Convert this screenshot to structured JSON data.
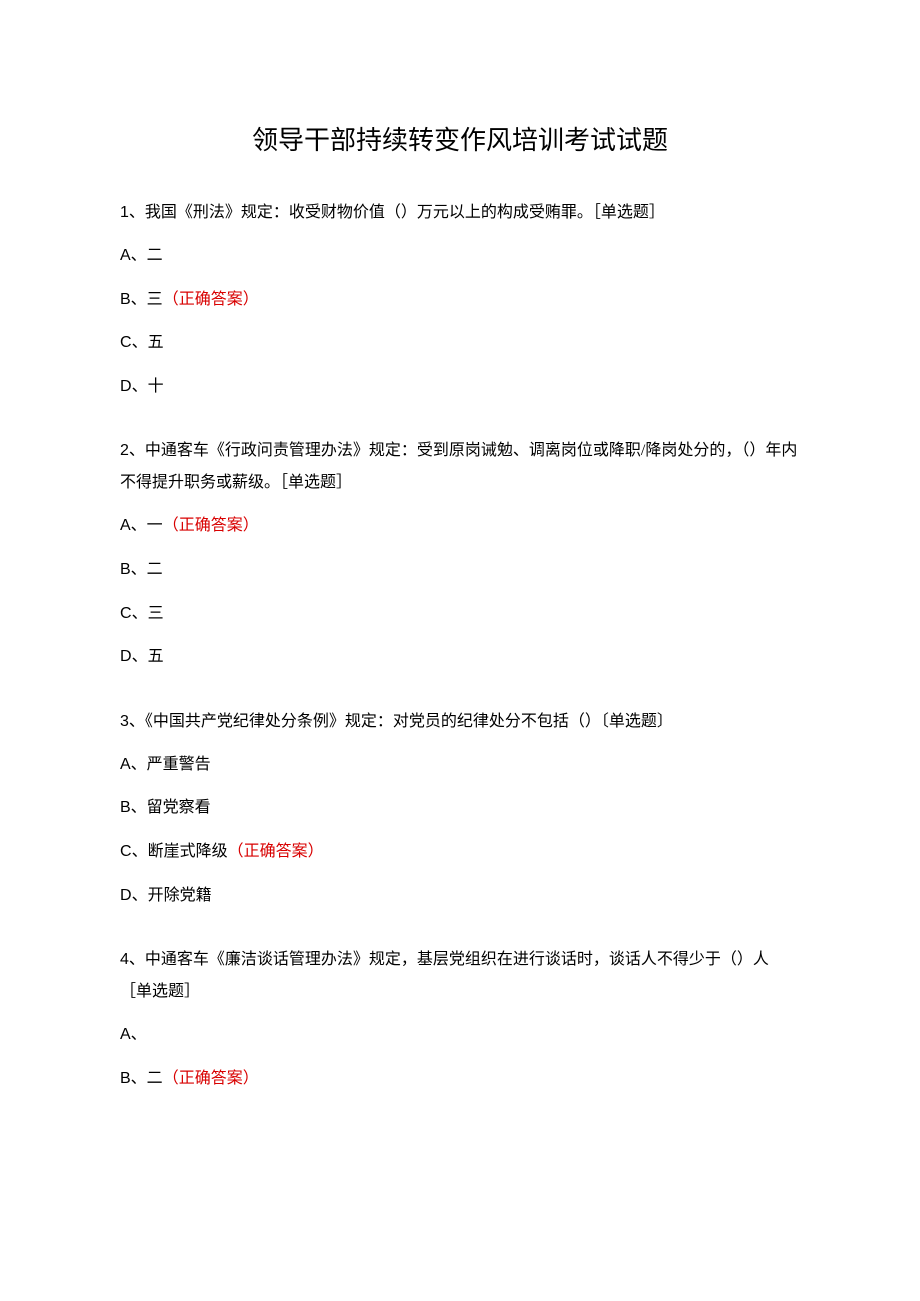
{
  "title": "领导干部持续转变作风培训考试试题",
  "correct_label": "（正确答案）",
  "questions": [
    {
      "number": "1",
      "text": "、我国《刑法》规定：收受财物价值（）万元以上的构成受贿罪。",
      "tag": "［单选题］",
      "options": [
        {
          "letter": "A",
          "text": "、二",
          "correct": false
        },
        {
          "letter": "B",
          "text": "、三",
          "correct": true
        },
        {
          "letter": "C",
          "text": "、五",
          "correct": false
        },
        {
          "letter": "D",
          "text": "、十",
          "correct": false
        }
      ]
    },
    {
      "number": "2",
      "text": "、中通客车《行政问责管理办法》规定：受到原岗诫勉、调离岗位或降职/降岗处分的，（）年内不得提升职务或薪级。",
      "tag": "［单选题］",
      "options": [
        {
          "letter": "A",
          "text": "、一",
          "correct": true
        },
        {
          "letter": "B",
          "text": "、二",
          "correct": false
        },
        {
          "letter": "C",
          "text": "、三",
          "correct": false
        },
        {
          "letter": "D",
          "text": "、五",
          "correct": false
        }
      ]
    },
    {
      "number": "3",
      "text": "、《中国共产党纪律处分条例》规定：对党员的纪律处分不包括（）",
      "tag": "〔单选题〕",
      "options": [
        {
          "letter": "A",
          "text": "、严重警告",
          "correct": false
        },
        {
          "letter": "B",
          "text": "、留党察看",
          "correct": false
        },
        {
          "letter": "C",
          "text": "、断崖式降级",
          "correct": true
        },
        {
          "letter": "D",
          "text": "、开除党籍",
          "correct": false
        }
      ]
    },
    {
      "number": "4",
      "text": "、中通客车《廉洁谈话管理办法》规定，基层党组织在进行谈话时，谈话人不得少于（）人",
      "tag": "［单选题］",
      "options": [
        {
          "letter": "A",
          "text": "、",
          "correct": false
        },
        {
          "letter": "B",
          "text": "、二",
          "correct": true
        }
      ]
    }
  ]
}
